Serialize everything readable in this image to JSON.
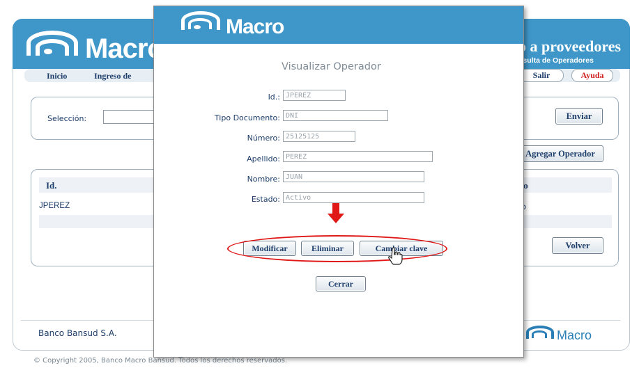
{
  "background": {
    "brand": "Macro",
    "header_title": "o a proveedores",
    "header_subtitle": "nsulta de Operadores",
    "nav": {
      "inicio": "Inicio",
      "ingreso": "Ingreso de",
      "salir": "Salir",
      "ayuda": "Ayuda"
    },
    "seleccion_label": "Selección:",
    "enviar_button": "Enviar",
    "agregar_operador_button": "Agregar Operador",
    "table": {
      "col_id": "Id.",
      "col_estado_partial": "do",
      "row_id": "JPEREZ",
      "row_estado_partial": "o"
    },
    "volver_button": "Volver",
    "footer_company": "Banco Bansud S.A.",
    "footer_logo": "Macro",
    "copyright": "© Copyright 2005, Banco Macro Bansud. Todos los derechos reservados."
  },
  "modal": {
    "brand": "Macro",
    "title": "Visualizar Operador",
    "fields": [
      {
        "label": "Id.:",
        "value": "JPEREZ"
      },
      {
        "label": "Tipo Documento:",
        "value": "DNI"
      },
      {
        "label": "Número:",
        "value": "25125125"
      },
      {
        "label": "Apellido:",
        "value": "PEREZ"
      },
      {
        "label": "Nombre:",
        "value": "JUAN"
      },
      {
        "label": "Estado:",
        "value": "Activo"
      }
    ],
    "buttons": {
      "modificar": "Modificar",
      "eliminar": "Eliminar",
      "cambiar_clave": "Cambiar clave",
      "cerrar": "Cerrar"
    }
  },
  "colors": {
    "brand_blue": "#3f96c8",
    "highlight_red": "#e01818",
    "text_navy": "#1d3d6a"
  },
  "icons": {
    "logo": "macro-logo-icon",
    "arrow": "red-down-arrow-icon",
    "cursor": "hand-pointer-icon"
  }
}
